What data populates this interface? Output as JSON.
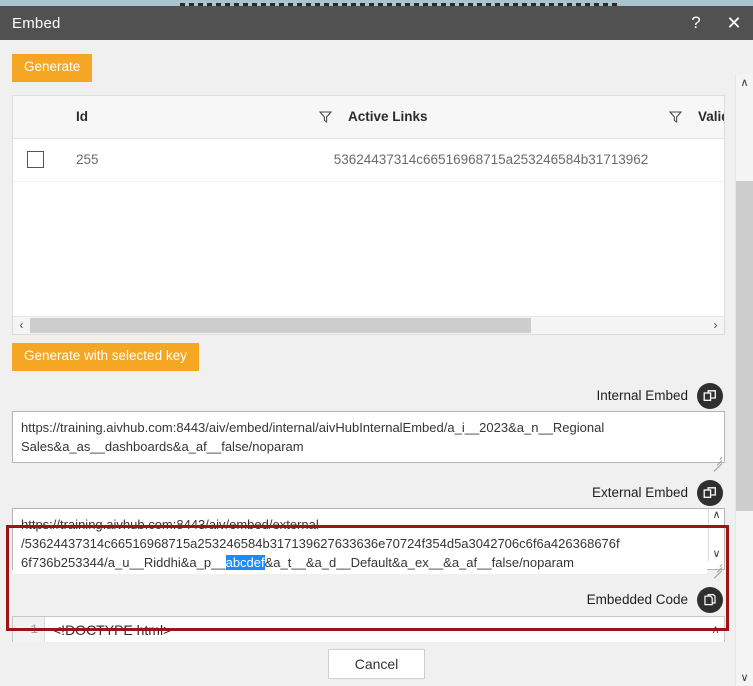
{
  "window": {
    "title": "Embed",
    "help_label": "?",
    "close_label": "✕"
  },
  "toolbar": {
    "generate_label": "Generate",
    "generate_selected_label": "Generate with selected key"
  },
  "grid": {
    "columns": [
      {
        "key": "id",
        "label": "Id",
        "has_filter": false
      },
      {
        "key": "active_links",
        "label": "Active Links",
        "has_filter": true
      },
      {
        "key": "valid",
        "label": "Valid",
        "has_filter": true
      }
    ],
    "rows": [
      {
        "checked": false,
        "id": "255",
        "active_links": "53624437314c66516968715a253246584b31713962"
      }
    ],
    "hscroll": {
      "left_arrow": "‹",
      "right_arrow": "›"
    }
  },
  "internal_embed": {
    "label": "Internal Embed",
    "copy_icon": "copy-icon",
    "value": "https://training.aivhub.com:8443/aiv/embed/internal/aivHubInternalEmbed/a_i__2023&a_n__Regional Sales&a_as__dashboards&a_af__false/noparam"
  },
  "external_embed": {
    "label": "External Embed",
    "copy_icon": "copy-icon",
    "value": "https://training.aivhub.com:8443/aiv/embed/external\n/53624437314c66516968715a253246584b317139627633636e70724f354d5a3042706c6f6a426368676f\n6f736b253344/a_u__Riddhi&a_p__abcdef&a_t__&a_d__Default&a_ex__&a_af__false/noparam",
    "line1": "https://training.aivhub.com:8443/aiv/embed/external",
    "line2": "/53624437314c66516968715a253246584b317139627633636e70724f354d5a3042706c6f6a426368676f",
    "line3_prefix": "6f736b253344/a_u__Riddhi&a_p__",
    "line3_selection": "abcdef",
    "line3_suffix": "&a_t__&a_d__Default&a_ex__&a_af__false/noparam",
    "selection_color": "#1a8cff",
    "scroll_up": "∧",
    "scroll_down": "∨"
  },
  "embedded_code": {
    "label": "Embedded Code",
    "copy_icon": "copy-pages-icon",
    "line_number": "1",
    "code": "<!DOCTYPE html>",
    "scroll_up": "∧",
    "scroll_down": "∨"
  },
  "footer": {
    "cancel_label": "Cancel"
  },
  "dialog_scroll": {
    "up_arrow": "∧",
    "down_arrow": "∨"
  },
  "colors": {
    "accent_orange": "#f5a623",
    "titlebar": "#515151",
    "highlight_red": "#9e1313",
    "selection_blue": "#1a8cff"
  }
}
